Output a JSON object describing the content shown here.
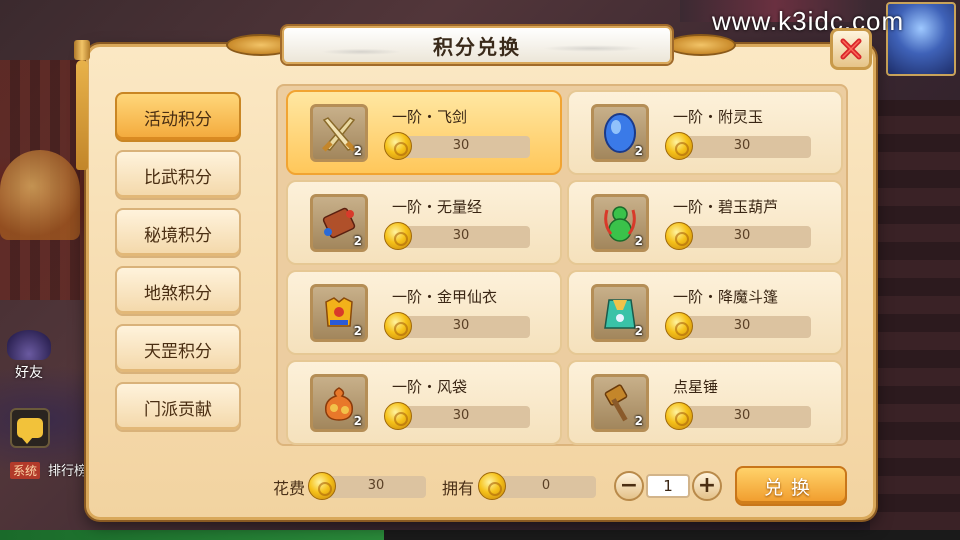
{
  "watermark": "www.k3idc.com",
  "overlay": {
    "friend_label": "好友",
    "system_tag": "系统",
    "rank_label": "排行榜"
  },
  "dialog": {
    "title": "积分兑换"
  },
  "tabs": [
    {
      "label": "活动积分",
      "active": true
    },
    {
      "label": "比武积分",
      "active": false
    },
    {
      "label": "秘境积分",
      "active": false
    },
    {
      "label": "地煞积分",
      "active": false
    },
    {
      "label": "天罡积分",
      "active": false
    },
    {
      "label": "门派贡献",
      "active": false
    }
  ],
  "items": [
    {
      "name": "一阶・飞剑",
      "count": "2",
      "price": "30",
      "icon": "crossed-swords-icon",
      "selected": true
    },
    {
      "name": "一阶・附灵玉",
      "count": "2",
      "price": "30",
      "icon": "blue-jade-icon",
      "selected": false
    },
    {
      "name": "一阶・无量经",
      "count": "2",
      "price": "30",
      "icon": "scroll-icon",
      "selected": false
    },
    {
      "name": "一阶・碧玉葫芦",
      "count": "2",
      "price": "30",
      "icon": "gourd-icon",
      "selected": false
    },
    {
      "name": "一阶・金甲仙衣",
      "count": "2",
      "price": "30",
      "icon": "gold-armor-icon",
      "selected": false
    },
    {
      "name": "一阶・降魔斗篷",
      "count": "2",
      "price": "30",
      "icon": "cloak-icon",
      "selected": false
    },
    {
      "name": "一阶・风袋",
      "count": "2",
      "price": "30",
      "icon": "wind-bag-icon",
      "selected": false
    },
    {
      "name": "点星锤",
      "count": "2",
      "price": "30",
      "icon": "hammer-icon",
      "selected": false
    }
  ],
  "footer": {
    "cost_label": "花费",
    "cost_value": "30",
    "own_label": "拥有",
    "own_value": "0",
    "quantity": "1",
    "minus": "−",
    "plus": "+",
    "exchange_label": "兑换"
  },
  "colors": {
    "accent": "#f3a83a",
    "panel_bg": "#fbe8c4",
    "close_red": "#d8262a"
  }
}
